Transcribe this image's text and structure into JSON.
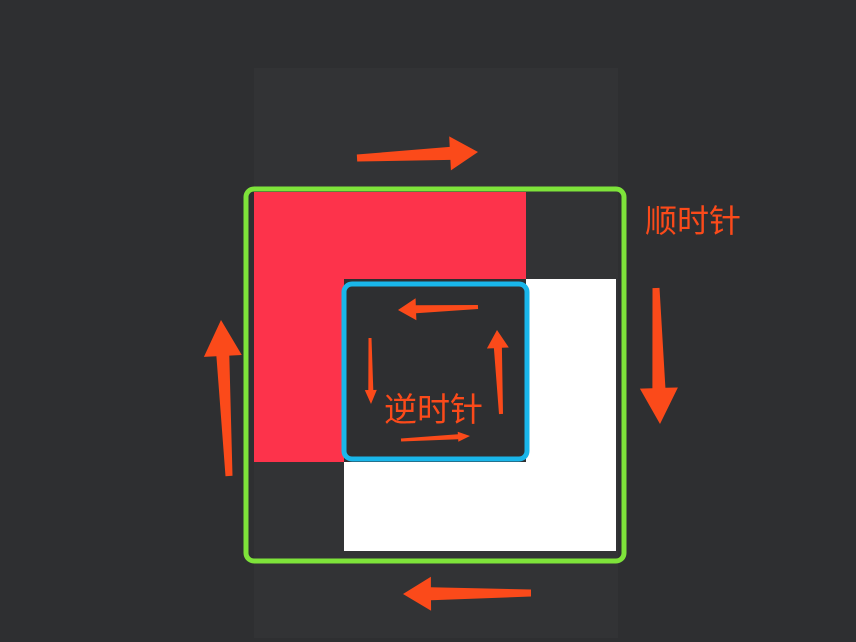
{
  "colors": {
    "background": "#2e2f31",
    "panel": "#323335",
    "red_square": "#fd334b",
    "white_square": "#ffffff",
    "outer_path": "#7ee33a",
    "inner_path": "#19b6ea",
    "arrow": "#fb4a1a",
    "label": "#fb4a1a"
  },
  "labels": {
    "clockwise": "顺时针",
    "counterclockwise": "逆时针"
  },
  "icons": {
    "arrow": "arrow-icon"
  },
  "outer_loop": {
    "direction": "clockwise",
    "arrows": [
      "right",
      "down",
      "left",
      "up"
    ]
  },
  "inner_loop": {
    "direction": "counterclockwise",
    "arrows": [
      "left",
      "down",
      "right",
      "up"
    ]
  }
}
